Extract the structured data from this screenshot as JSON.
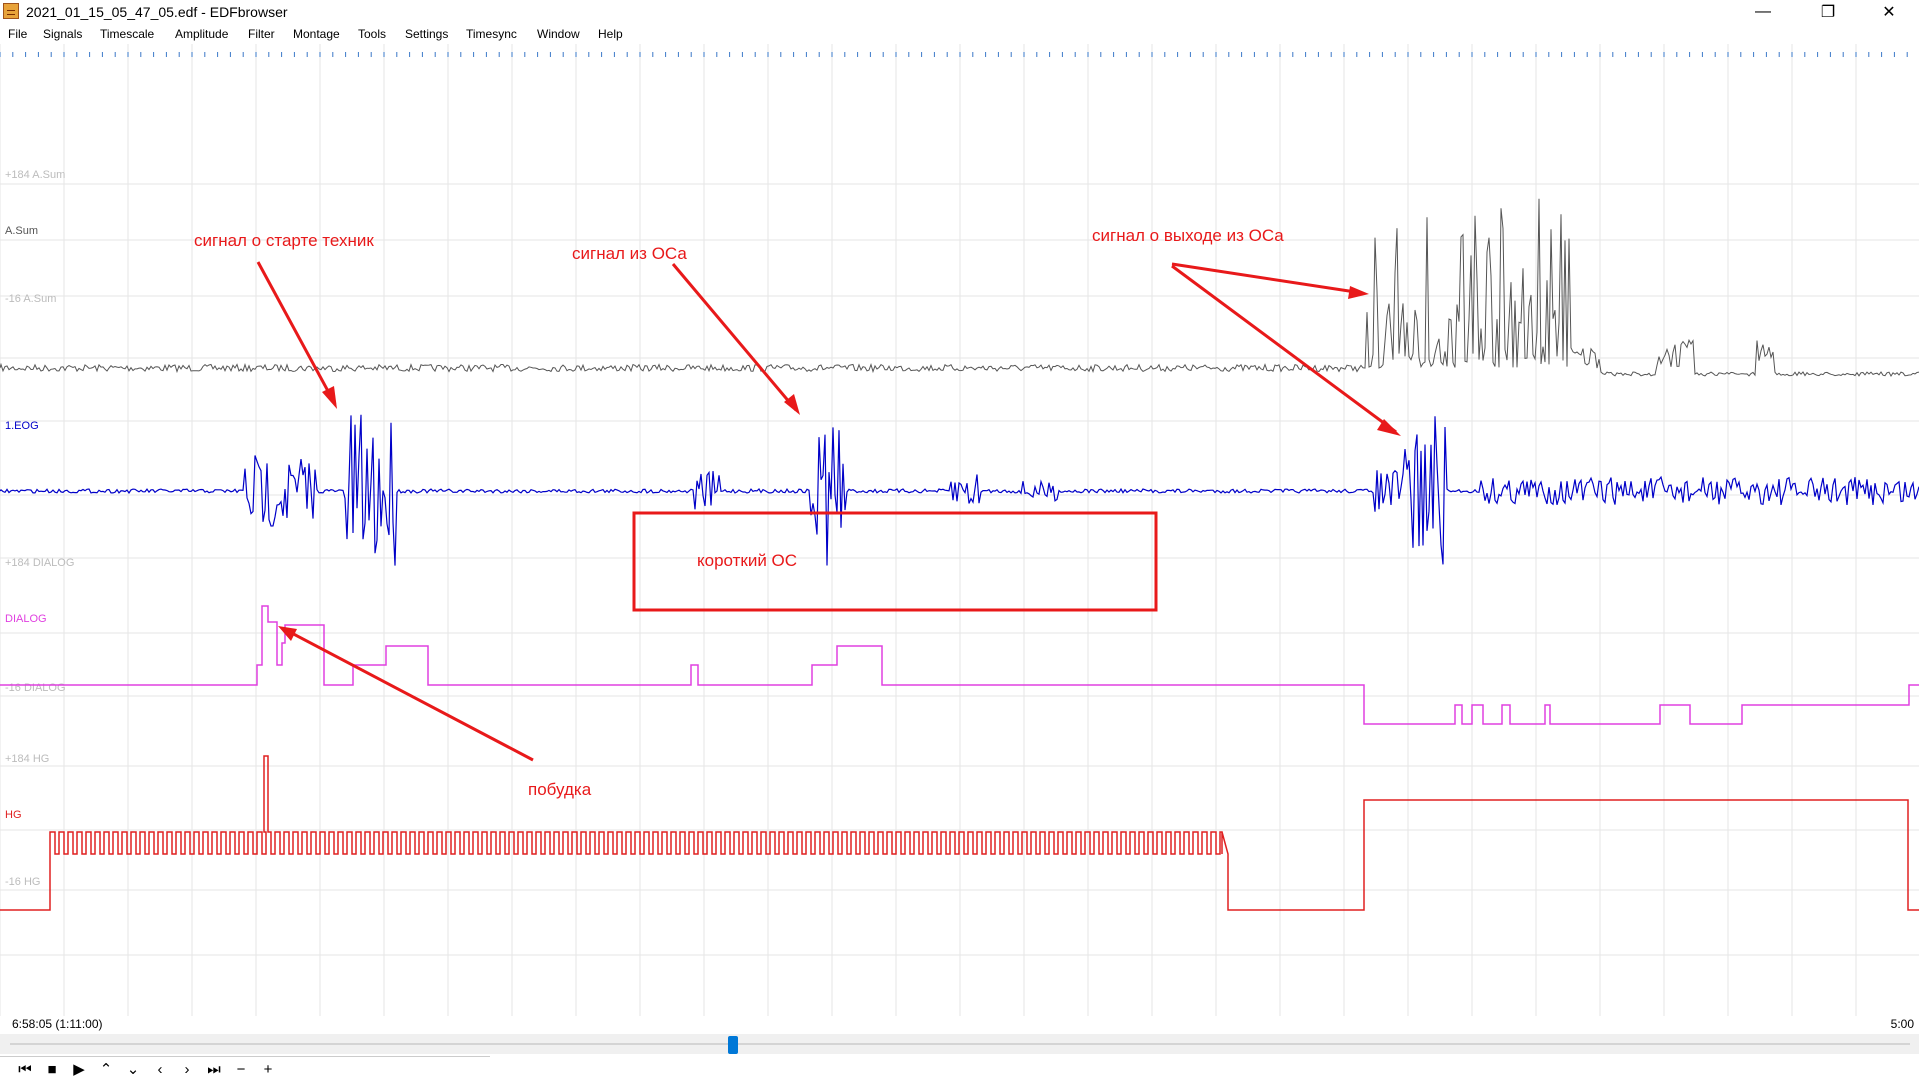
{
  "window": {
    "title": "2021_01_15_05_47_05.edf - EDFbrowser",
    "minimize_glyph": "—",
    "maximize_glyph": "❐",
    "close_glyph": "✕"
  },
  "menu": [
    {
      "label": "File"
    },
    {
      "label": "Signals"
    },
    {
      "label": "Timescale"
    },
    {
      "label": "Amplitude"
    },
    {
      "label": "Filter"
    },
    {
      "label": "Montage"
    },
    {
      "label": "Tools"
    },
    {
      "label": "Settings"
    },
    {
      "label": "Timesync"
    },
    {
      "label": "Window"
    },
    {
      "label": "Help"
    }
  ],
  "signals": [
    {
      "name": "A.Sum",
      "color": "#555555",
      "scale_top": "+184 A.Sum",
      "scale_bottom": "-16 A.Sum"
    },
    {
      "name": "1.EOG",
      "color": "#0000c8",
      "scale_top": "",
      "scale_bottom": ""
    },
    {
      "name": "DIALOG",
      "color": "#e040e0",
      "scale_top": "+184 DIALOG",
      "scale_bottom": "-16 DIALOG"
    },
    {
      "name": "HG",
      "color": "#e02020",
      "scale_top": "+184 HG",
      "scale_bottom": "-16 HG"
    }
  ],
  "annotations": {
    "start_signal": "сигнал о старте техник",
    "rem_signal": "сигнал из ОСа",
    "exit_signal": "сигнал о выходе из ОСа",
    "short_rem": "короткий ОС",
    "wakeup": "побудка"
  },
  "annotation_color": "#e8191a",
  "timeline": {
    "start_time": "6:58:05 (1:11:00)",
    "end_time": "5:00",
    "position_percent": 38
  },
  "nav_buttons": [
    {
      "name": "first-icon",
      "glyph": "⏮"
    },
    {
      "name": "stop-icon",
      "glyph": "■"
    },
    {
      "name": "play-icon",
      "glyph": "▶"
    },
    {
      "name": "chevron-up-icon",
      "glyph": "⌃"
    },
    {
      "name": "chevron-down-icon",
      "glyph": "⌄"
    },
    {
      "name": "chevron-left-icon",
      "glyph": "‹"
    },
    {
      "name": "chevron-right-icon",
      "glyph": "›"
    },
    {
      "name": "last-icon",
      "glyph": "⏭"
    },
    {
      "name": "minus-icon",
      "glyph": "−"
    },
    {
      "name": "plus-icon",
      "glyph": "+"
    }
  ]
}
